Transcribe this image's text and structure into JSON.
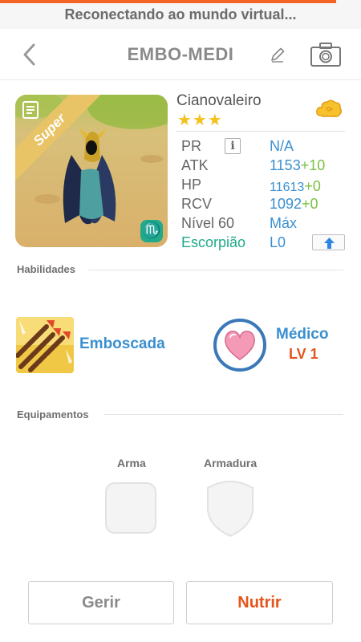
{
  "status": {
    "text": "Reconectando ao mundo virtual...",
    "progress": 0.93,
    "accent_color": "#f26522"
  },
  "header": {
    "title": "EMBO-MEDI",
    "back_icon": "chevron-left-icon",
    "edit_icon": "pencil-icon",
    "camera_icon": "camera-icon"
  },
  "monster": {
    "name": "Cianovaleiro",
    "rarity_badge": "Super",
    "stars": "★★★",
    "star_count": 3,
    "element_icon": "cloud-element-icon",
    "zodiac_symbol": "♏",
    "stats": {
      "pr_label": "PR",
      "pr_value": "N/A",
      "atk_label": "ATK",
      "atk_value": "1153",
      "atk_bonus": "+10",
      "hp_label": "HP",
      "hp_value": "11613",
      "hp_bonus": "+0",
      "rcv_label": "RCV",
      "rcv_value": "1092",
      "rcv_bonus": "+0",
      "level_label": "Nível 60",
      "level_value": "Máx",
      "zodiac_label": "Escorpião",
      "zodiac_value": "L0"
    }
  },
  "skills": {
    "section_title": "Habilidades",
    "active_name": "Emboscada",
    "leader_name": "Médico",
    "leader_level": "LV 1"
  },
  "equipment": {
    "section_title": "Equipamentos",
    "weapon_label": "Arma",
    "armor_label": "Armadura"
  },
  "actions": {
    "manage_label": "Gerir",
    "feed_label": "Nutrir"
  },
  "colors": {
    "link_blue": "#3a8fd0",
    "bonus_green": "#7ac143",
    "zodiac_green": "#20a98a",
    "orange": "#e5541b",
    "star_gold": "#f4c21f"
  }
}
